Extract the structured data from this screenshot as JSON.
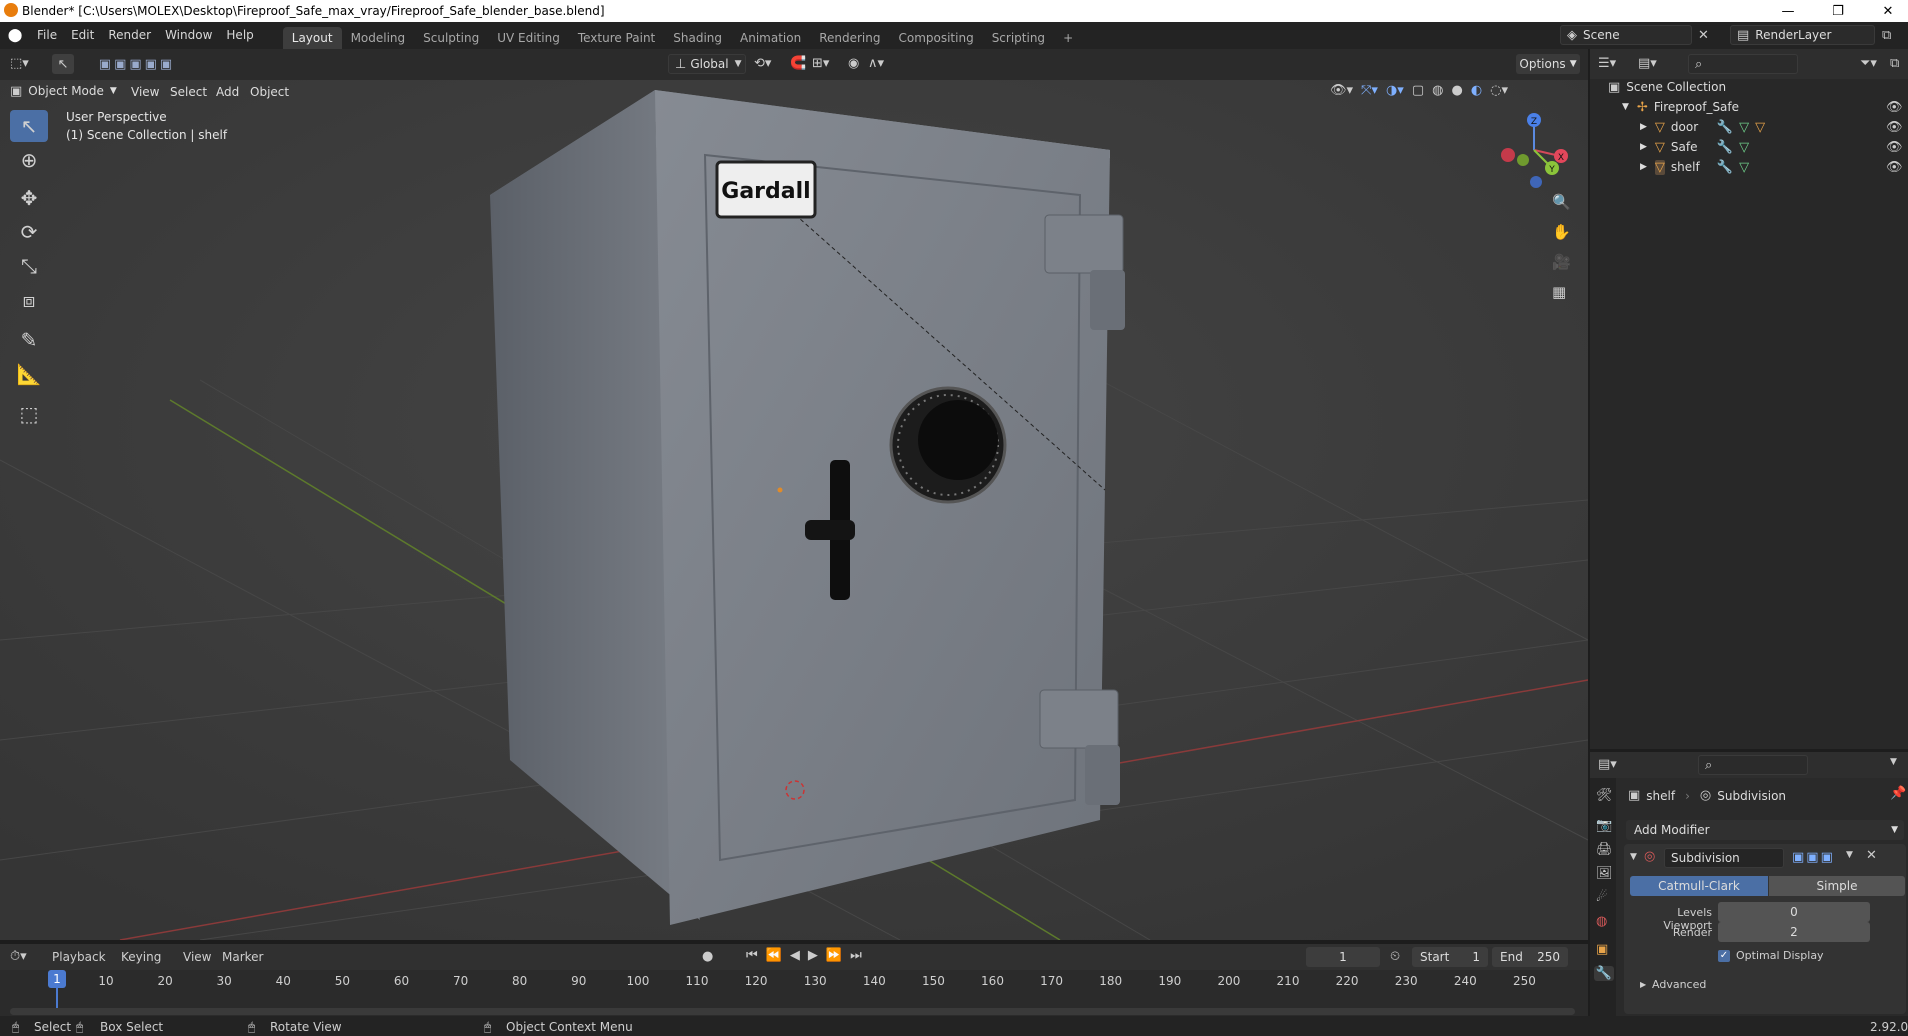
{
  "window": {
    "title": "Blender* [C:\\Users\\MOLEX\\Desktop\\Fireproof_Safe_max_vray/Fireproof_Safe_blender_base.blend]",
    "minimize": "—",
    "restore": "❐",
    "close": "✕"
  },
  "menus": [
    "File",
    "Edit",
    "Render",
    "Window",
    "Help"
  ],
  "workspaces": [
    {
      "label": "Layout",
      "active": true
    },
    {
      "label": "Modeling"
    },
    {
      "label": "Sculpting"
    },
    {
      "label": "UV Editing"
    },
    {
      "label": "Texture Paint"
    },
    {
      "label": "Shading"
    },
    {
      "label": "Animation"
    },
    {
      "label": "Rendering"
    },
    {
      "label": "Compositing"
    },
    {
      "label": "Scripting"
    }
  ],
  "add_workspace": "+",
  "scene": {
    "name": "Scene",
    "render_layer": "RenderLayer"
  },
  "viewport_header": {
    "transform_orientation": "Global",
    "options": "Options",
    "mode": "Object Mode",
    "menus": [
      "View",
      "Select",
      "Add",
      "Object"
    ]
  },
  "viewport": {
    "perspective": "User Perspective",
    "collection_info": "(1) Scene Collection | shelf",
    "brand_label": "Gardall",
    "gizmo": {
      "x": "X",
      "y": "Y",
      "z": "Z"
    }
  },
  "outliner": {
    "root": "Scene Collection",
    "collection": "Fireproof_Safe",
    "items": [
      {
        "name": "door"
      },
      {
        "name": "Safe"
      },
      {
        "name": "shelf"
      }
    ]
  },
  "properties": {
    "object": "shelf",
    "modifier_breadcrumb": "Subdivision",
    "add_modifier": "Add Modifier",
    "modifier": {
      "name": "Subdivision",
      "type_options": [
        "Catmull-Clark",
        "Simple"
      ],
      "selected_type": "Catmull-Clark",
      "levels_viewport_label": "Levels Viewport",
      "levels_viewport": "0",
      "render_label": "Render",
      "render": "2",
      "optimal_display_label": "Optimal Display",
      "optimal_display": true,
      "advanced": "Advanced"
    }
  },
  "timeline": {
    "menus": [
      "Playback",
      "Keying",
      "View",
      "Marker"
    ],
    "current_frame": "1",
    "start_label": "Start",
    "start": "1",
    "end_label": "End",
    "end": "250",
    "ticks": [
      "10",
      "20",
      "30",
      "40",
      "50",
      "60",
      "70",
      "80",
      "90",
      "100",
      "110",
      "120",
      "130",
      "140",
      "150",
      "160",
      "170",
      "180",
      "190",
      "200",
      "210",
      "220",
      "230",
      "240",
      "250"
    ],
    "playhead": "1"
  },
  "statusbar": {
    "select": "Select",
    "box_select": "Box Select",
    "rotate": "Rotate View",
    "context": "Object Context Menu",
    "version": "2.92.0"
  }
}
